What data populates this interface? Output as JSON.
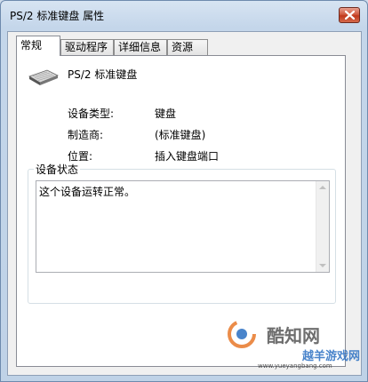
{
  "window": {
    "title": "PS/2 标准键盘 属性"
  },
  "tabs": [
    {
      "label": "常规",
      "active": true
    },
    {
      "label": "驱动程序",
      "active": false
    },
    {
      "label": "详细信息",
      "active": false
    },
    {
      "label": "资源",
      "active": false
    }
  ],
  "device": {
    "name": "PS/2 标准键盘",
    "icon": "keyboard-icon"
  },
  "properties": [
    {
      "label": "设备类型:",
      "value": "键盘"
    },
    {
      "label": "制造商:",
      "value": "(标准键盘)"
    },
    {
      "label": "位置:",
      "value": "插入键盘端口"
    }
  ],
  "status": {
    "group_title": "设备状态",
    "text": "这个设备运转正常。"
  },
  "watermark": {
    "text1": "酷知网",
    "text2": "越羊游戏网",
    "url": "www.yueyangbang.com"
  },
  "colors": {
    "close_button": "#c0381c",
    "watermark_orange": "#e8792a",
    "watermark_blue": "#2a6fc2"
  }
}
